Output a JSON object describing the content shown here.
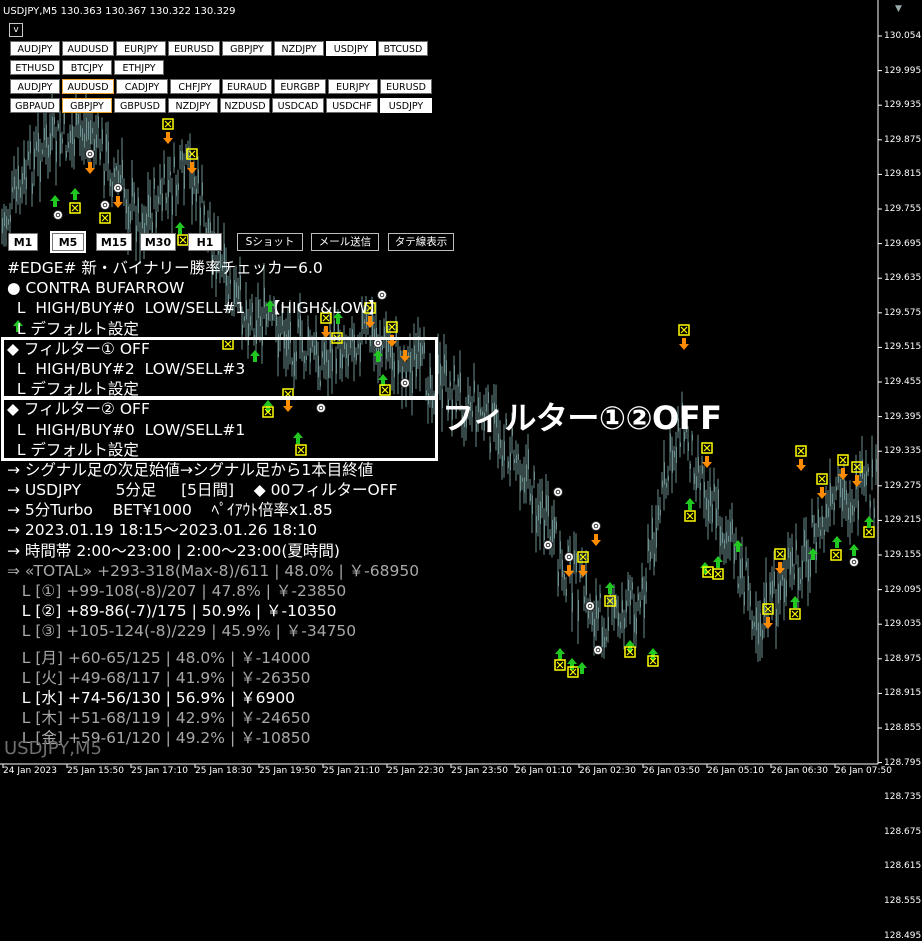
{
  "header": {
    "symbol_text": "USDJPY,M5  130.363 130.367 130.322 130.329"
  },
  "collapse_label": "v",
  "pair_rows": [
    [
      "AUDJPY",
      "AUDUSD",
      "EURJPY",
      "EURUSD",
      "GBPJPY",
      "NZDJPY",
      "USDJPY",
      "BTCUSD"
    ],
    [
      "ETHUSD",
      "BTCJPY",
      "ETHJPY"
    ],
    [
      "AUDJPY",
      "AUDUSD",
      "CADJPY",
      "CHFJPY",
      "EURAUD",
      "EURGBP",
      "EURJPY",
      "EURUSD"
    ],
    [
      "GBPAUD",
      "GBPJPY",
      "GBPUSD",
      "NZDJPY",
      "NZDUSD",
      "USDCAD",
      "USDCHF",
      "USDJPY"
    ]
  ],
  "timeframes": [
    "M1",
    "M5",
    "M15",
    "M30",
    "H1"
  ],
  "function_buttons": [
    "Sショット",
    "メール送信",
    "タテ線表示"
  ],
  "panel": {
    "lines": [
      "#EDGE# 新・バイナリー勝率チェッカー6.0",
      "● CONTRA BUFARROW",
      "  L  HIGH/BUY#0  LOW/SELL#1    【HIGH&LOW】",
      "  L デフォルト設定",
      "◆ フィルター① OFF",
      "  L  HIGH/BUY#2  LOW/SELL#3",
      "  L デフォルト設定",
      "◆ フィルター② OFF",
      "  L  HIGH/BUY#0  LOW/SELL#1",
      "  L デフォルト設定",
      "→ シグナル足の次足始値→シグナル足から1本目終値",
      "→ USDJPY       5分足     [5日間]    ◆ 00フィルターOFF",
      "→ 5分Turbo    BET¥1000    ﾍﾟｲｱｳﾄ倍率x1.85",
      "→ 2023.01.19 18:15～2023.01.26 18:10",
      "→ 時間帯 2:00～23:00 | 2:00～23:00(夏時間)"
    ],
    "total": "⇒ «TOTAL» +293-318(Max-8)/611 | 48.0% | ￥-68950",
    "stats": [
      {
        "text": "   L [①] +99-108(-8)/207 | 47.8% | ￥-23850",
        "tone": "gray"
      },
      {
        "text": "   L [②] +89-86(-7)/175 | 50.9% | ￥-10350",
        "tone": "white"
      },
      {
        "text": "   L [③] +105-124(-8)/229 | 45.9% | ￥-34750",
        "tone": "gray"
      }
    ],
    "days": [
      {
        "text": "   L [月] +60-65/125 | 48.0% | ￥-14000",
        "tone": "gray"
      },
      {
        "text": "   L [火] +49-68/117 | 41.9% | ￥-26350",
        "tone": "gray"
      },
      {
        "text": "   L [水] +74-56/130 | 56.9% | ￥6900",
        "tone": "white"
      },
      {
        "text": "   L [木] +51-68/119 | 42.9% | ￥-24650",
        "tone": "gray"
      },
      {
        "text": "   L [金] +59-61/120 | 49.2% | ￥-10850",
        "tone": "gray"
      }
    ]
  },
  "callout": "フィルター①②OFF",
  "watermark": "USDJPY,M5",
  "price_axis": [
    "130.054",
    "129.995",
    "129.935",
    "129.875",
    "129.815",
    "129.755",
    "129.695",
    "129.635",
    "129.575",
    "129.515",
    "129.455",
    "129.395",
    "129.335",
    "129.275",
    "129.215",
    "129.155",
    "129.095",
    "129.035",
    "128.975",
    "128.915",
    "128.855",
    "128.795",
    "128.735",
    "128.675",
    "128.615",
    "128.555",
    "128.495"
  ],
  "time_axis": [
    "24 Jan 2023",
    "25 Jan 15:50",
    "25 Jan 17:10",
    "25 Jan 18:30",
    "25 Jan 19:50",
    "25 Jan 21:10",
    "25 Jan 22:30",
    "25 Jan 23:50",
    "26 Jan 01:10",
    "26 Jan 02:30",
    "26 Jan 03:50",
    "26 Jan 05:10",
    "26 Jan 06:30",
    "26 Jan 07:50"
  ],
  "colors": {
    "up_arrow": "#22c822",
    "down_arrow": "#ff8c00",
    "loss_box": "#ffff00",
    "candle": "#6b8e8e"
  }
}
